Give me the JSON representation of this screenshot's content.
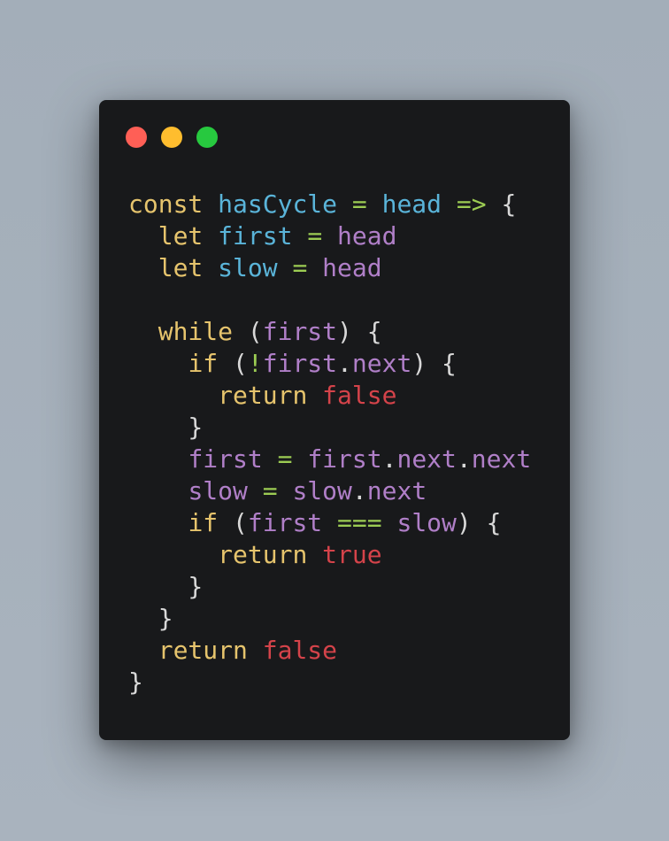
{
  "window": {
    "controls": {
      "close_color": "#ff5f56",
      "minimize_color": "#ffbd2e",
      "maximize_color": "#27c93f"
    }
  },
  "code": {
    "language": "javascript",
    "lines": [
      [
        [
          "kw",
          "const"
        ],
        [
          "punc",
          " "
        ],
        [
          "fn",
          "hasCycle"
        ],
        [
          "punc",
          " "
        ],
        [
          "op",
          "="
        ],
        [
          "punc",
          " "
        ],
        [
          "fn",
          "head"
        ],
        [
          "punc",
          " "
        ],
        [
          "op",
          "=>"
        ],
        [
          "punc",
          " {"
        ]
      ],
      [
        [
          "punc",
          "  "
        ],
        [
          "kw",
          "let"
        ],
        [
          "punc",
          " "
        ],
        [
          "fn",
          "first"
        ],
        [
          "punc",
          " "
        ],
        [
          "op",
          "="
        ],
        [
          "punc",
          " "
        ],
        [
          "var",
          "head"
        ]
      ],
      [
        [
          "punc",
          "  "
        ],
        [
          "kw",
          "let"
        ],
        [
          "punc",
          " "
        ],
        [
          "fn",
          "slow"
        ],
        [
          "punc",
          " "
        ],
        [
          "op",
          "="
        ],
        [
          "punc",
          " "
        ],
        [
          "var",
          "head"
        ]
      ],
      [],
      [
        [
          "punc",
          "  "
        ],
        [
          "kw",
          "while"
        ],
        [
          "punc",
          " ("
        ],
        [
          "var",
          "first"
        ],
        [
          "punc",
          ") {"
        ]
      ],
      [
        [
          "punc",
          "    "
        ],
        [
          "kw",
          "if"
        ],
        [
          "punc",
          " ("
        ],
        [
          "op",
          "!"
        ],
        [
          "var",
          "first"
        ],
        [
          "punc",
          "."
        ],
        [
          "prop",
          "next"
        ],
        [
          "punc",
          ") {"
        ]
      ],
      [
        [
          "punc",
          "      "
        ],
        [
          "kw",
          "return"
        ],
        [
          "punc",
          " "
        ],
        [
          "bool",
          "false"
        ]
      ],
      [
        [
          "punc",
          "    }"
        ]
      ],
      [
        [
          "punc",
          "    "
        ],
        [
          "var",
          "first"
        ],
        [
          "punc",
          " "
        ],
        [
          "op",
          "="
        ],
        [
          "punc",
          " "
        ],
        [
          "var",
          "first"
        ],
        [
          "punc",
          "."
        ],
        [
          "prop",
          "next"
        ],
        [
          "punc",
          "."
        ],
        [
          "prop",
          "next"
        ]
      ],
      [
        [
          "punc",
          "    "
        ],
        [
          "var",
          "slow"
        ],
        [
          "punc",
          " "
        ],
        [
          "op",
          "="
        ],
        [
          "punc",
          " "
        ],
        [
          "var",
          "slow"
        ],
        [
          "punc",
          "."
        ],
        [
          "prop",
          "next"
        ]
      ],
      [
        [
          "punc",
          "    "
        ],
        [
          "kw",
          "if"
        ],
        [
          "punc",
          " ("
        ],
        [
          "var",
          "first"
        ],
        [
          "punc",
          " "
        ],
        [
          "op",
          "==="
        ],
        [
          "punc",
          " "
        ],
        [
          "var",
          "slow"
        ],
        [
          "punc",
          ") {"
        ]
      ],
      [
        [
          "punc",
          "      "
        ],
        [
          "kw",
          "return"
        ],
        [
          "punc",
          " "
        ],
        [
          "bool",
          "true"
        ]
      ],
      [
        [
          "punc",
          "    }"
        ]
      ],
      [
        [
          "punc",
          "  }"
        ]
      ],
      [
        [
          "punc",
          "  "
        ],
        [
          "kw",
          "return"
        ],
        [
          "punc",
          " "
        ],
        [
          "bool",
          "false"
        ]
      ],
      [
        [
          "punc",
          "}"
        ]
      ]
    ]
  }
}
